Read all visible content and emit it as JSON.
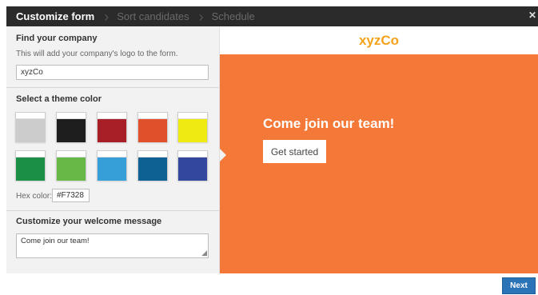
{
  "wizard": {
    "steps": [
      {
        "label": "Customize form",
        "active": true
      },
      {
        "label": "Sort candidates",
        "active": false
      },
      {
        "label": "Schedule",
        "active": false
      }
    ],
    "close_icon": "close-icon"
  },
  "company": {
    "title": "Find your company",
    "help": "This will add your company's logo to the form.",
    "value": "xyzCo"
  },
  "theme": {
    "title": "Select a theme color",
    "swatches": [
      "#cccccc",
      "#1e1e1e",
      "#a91f27",
      "#e0502a",
      "#eeea12",
      "#1a8f45",
      "#68b848",
      "#379fd8",
      "#0e6293",
      "#34479f"
    ],
    "hex_label": "Hex color:",
    "hex_value": "#F7328"
  },
  "welcome_section": {
    "title": "Customize your welcome message",
    "message": "Come join our team!"
  },
  "preview": {
    "logo_text": "xyzCo",
    "heading": "Come join our team!",
    "cta_label": "Get started",
    "background_color": "#f47938"
  },
  "footer": {
    "next_label": "Next"
  }
}
